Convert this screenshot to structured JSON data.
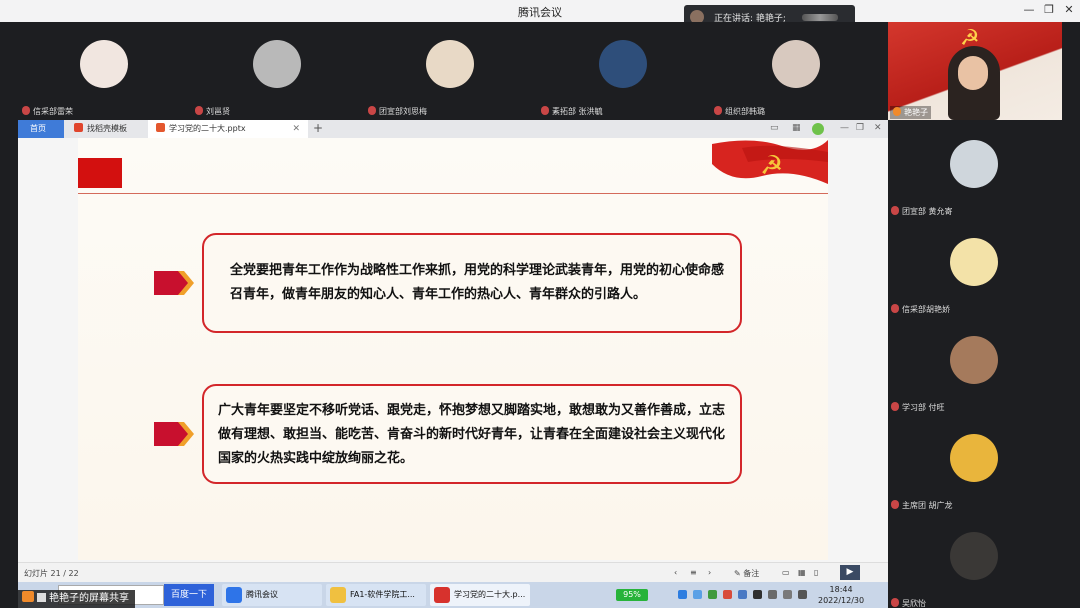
{
  "window": {
    "title": "腾讯会议",
    "minimize": "—",
    "restore": "❐",
    "close": "✕"
  },
  "speaking_indicator": {
    "text": "正在讲话: 艳艳子;"
  },
  "participants_top": [
    {
      "name": "信采部雷荣",
      "color": "#f1e6e0"
    },
    {
      "name": "刘邕贤",
      "color": "#b9b9b9"
    },
    {
      "name": "团宣部刘思梅",
      "color": "#e8d9c6"
    },
    {
      "name": "素拓部 张洪毓",
      "color": "#2e4e7a"
    },
    {
      "name": "组织部韩璐",
      "color": "#d8c9bf"
    }
  ],
  "main_speaker": {
    "name": "艳艳子",
    "emblem": "☭"
  },
  "participants_right": [
    {
      "name": "团宣部 黄允寄",
      "color": "#cfd6dc"
    },
    {
      "name": "信采部胡艳娇",
      "color": "#f3e2a8"
    },
    {
      "name": "学习部 付旺",
      "color": "#a57a5c"
    },
    {
      "name": "主席团 胡广龙",
      "color": "#e9b53c"
    },
    {
      "name": "吴欣怡",
      "color": "#3a3836"
    }
  ],
  "app_tabs": {
    "home": "首页",
    "template": "找稻壳模板",
    "document": "学习党的二十大.pptx",
    "add": "+",
    "close": "✕"
  },
  "slide": {
    "emblem": "☭",
    "box1_text": "全党要把青年工作作为战略性工作来抓，用党的科学理论武装青年，用党的初心使命感召青年，做青年朋友的知心人、青年工作的热心人、青年群众的引路人。",
    "box2_text": "广大青年要坚定不移听党话、跟党走，怀抱梦想又脚踏实地，敢想敢为又善作善成，立志做有理想、敢担当、能吃苦、肯奋斗的新时代好青年，让青春在全面建设社会主义现代化国家的火热实践中绽放绚丽之花。"
  },
  "status": {
    "slide_count": "幻灯片 21 / 22",
    "note": "备注"
  },
  "taskbar": {
    "search_placeholder": "",
    "baidu": "百度一下",
    "items": [
      "腾讯会议",
      "FA1-软件学院工...",
      "学习党的二十大.p..."
    ],
    "battery": "95%",
    "time": "18:44",
    "date": "2022/12/30"
  },
  "share_label": "艳艳子的屏幕共享"
}
